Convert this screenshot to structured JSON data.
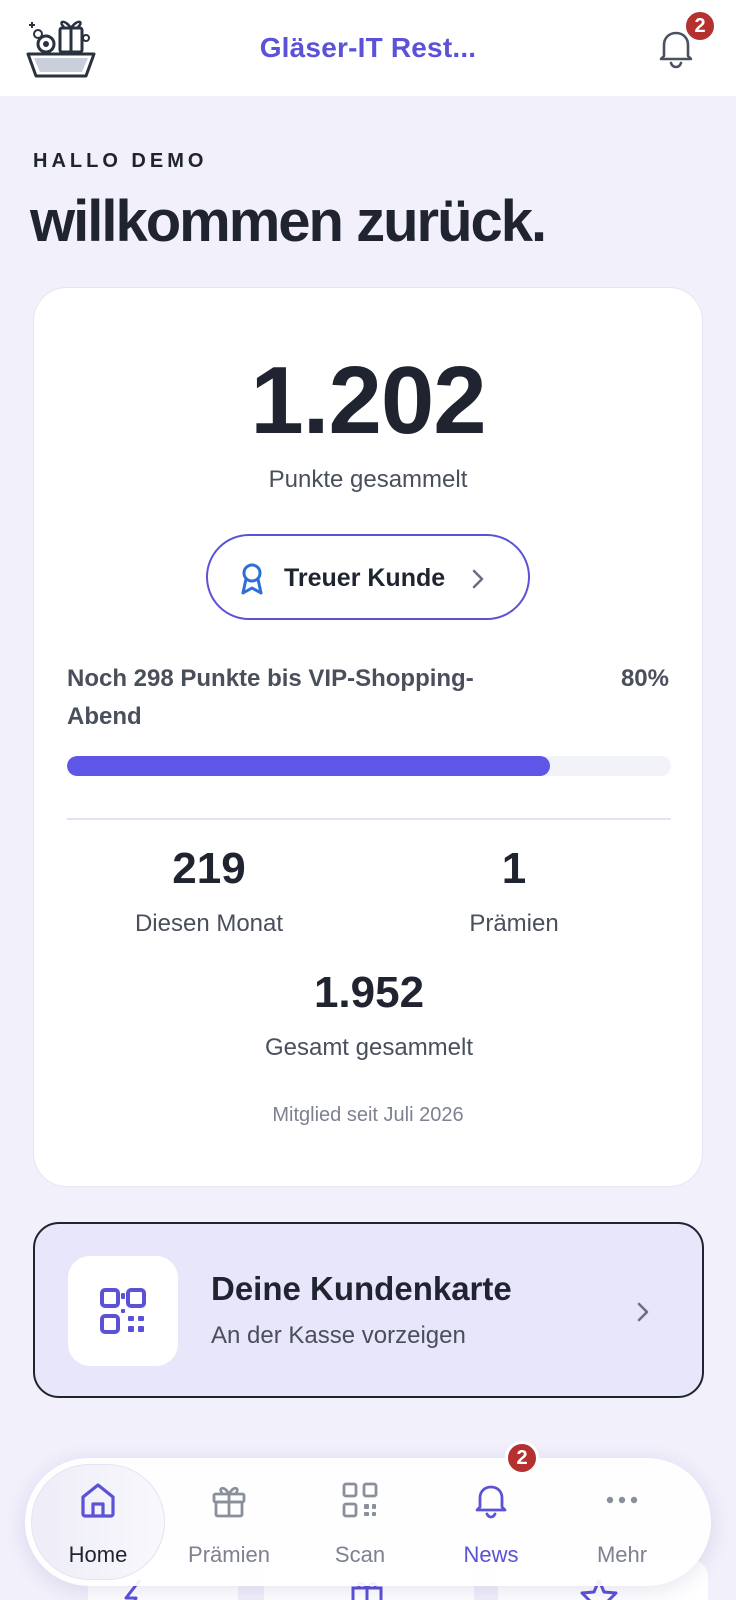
{
  "header": {
    "title": "Gläser-IT Rest...",
    "notification_count": "2"
  },
  "greeting": {
    "small": "HALLO DEMO",
    "big": "willkommen zurück."
  },
  "points_card": {
    "points": "1.202",
    "points_label": "Punkte gesammelt",
    "status_label": "Treuer Kunde",
    "progress_text": "Noch 298 Punkte bis VIP-Shopping-Abend",
    "progress_percent_label": "80%",
    "progress_fraction": 0.8,
    "stats": [
      {
        "value": "219",
        "label": "Diesen Monat"
      },
      {
        "value": "1",
        "label": "Prämien"
      },
      {
        "value": "1.952",
        "label": "Gesamt gesammelt"
      }
    ],
    "member_since": "Mitglied seit Juli 2026"
  },
  "customer_card": {
    "title": "Deine Kundenkarte",
    "subtitle": "An der Kasse vorzeigen"
  },
  "nav": {
    "items": [
      {
        "label": "Home",
        "icon": "home-icon",
        "active": true
      },
      {
        "label": "Prämien",
        "icon": "gift-icon",
        "active": false
      },
      {
        "label": "Scan",
        "icon": "qr-icon",
        "active": false
      },
      {
        "label": "News",
        "icon": "bell-icon",
        "active": false
      },
      {
        "label": "Mehr",
        "icon": "more-icon",
        "active": false
      }
    ],
    "news_badge": "2"
  },
  "colors": {
    "accent": "#5b52d6",
    "progress": "#5f56e8",
    "badge": "#b4312f",
    "background": "#f1f0fb",
    "text": "#1f2430"
  }
}
